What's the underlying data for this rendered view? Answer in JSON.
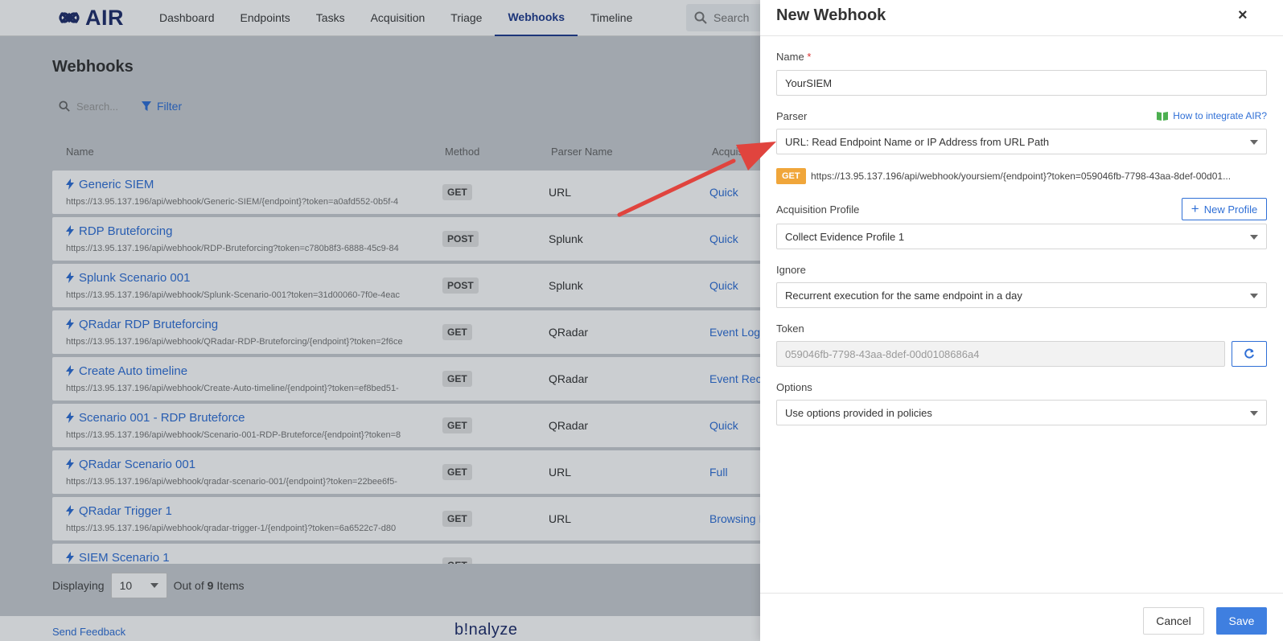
{
  "app": {
    "logo_text": "AIR"
  },
  "nav": {
    "items": [
      "Dashboard",
      "Endpoints",
      "Tasks",
      "Acquisition",
      "Triage",
      "Webhooks",
      "Timeline"
    ],
    "active": "Webhooks",
    "search_placeholder": "Search"
  },
  "page": {
    "title": "Webhooks",
    "search_placeholder": "Search...",
    "filter_label": "Filter"
  },
  "table": {
    "columns": [
      "Name",
      "Method",
      "Parser Name",
      "Acquisition"
    ],
    "rows": [
      {
        "name": "Generic SIEM",
        "url": "https://13.95.137.196/api/webhook/Generic-SIEM/{endpoint}?token=a0afd552-0b5f-4",
        "method": "GET",
        "parser": "URL",
        "acquisition": "Quick"
      },
      {
        "name": "RDP Bruteforcing",
        "url": "https://13.95.137.196/api/webhook/RDP-Bruteforcing?token=c780b8f3-6888-45c9-84",
        "method": "POST",
        "parser": "Splunk",
        "acquisition": "Quick"
      },
      {
        "name": "Splunk Scenario 001",
        "url": "https://13.95.137.196/api/webhook/Splunk-Scenario-001?token=31d00060-7f0e-4eac",
        "method": "POST",
        "parser": "Splunk",
        "acquisition": "Quick"
      },
      {
        "name": "QRadar RDP Bruteforcing",
        "url": "https://13.95.137.196/api/webhook/QRadar-RDP-Bruteforcing/{endpoint}?token=2f6ce",
        "method": "GET",
        "parser": "QRadar",
        "acquisition": "Event Logs"
      },
      {
        "name": "Create Auto timeline",
        "url": "https://13.95.137.196/api/webhook/Create-Auto-timeline/{endpoint}?token=ef8bed51-",
        "method": "GET",
        "parser": "QRadar",
        "acquisition": "Event Rec"
      },
      {
        "name": "Scenario 001 - RDP Bruteforce",
        "url": "https://13.95.137.196/api/webhook/Scenario-001-RDP-Bruteforce/{endpoint}?token=8",
        "method": "GET",
        "parser": "QRadar",
        "acquisition": "Quick"
      },
      {
        "name": "QRadar Scenario 001",
        "url": "https://13.95.137.196/api/webhook/qradar-scenario-001/{endpoint}?token=22bee6f5-",
        "method": "GET",
        "parser": "URL",
        "acquisition": "Full"
      },
      {
        "name": "QRadar Trigger 1",
        "url": "https://13.95.137.196/api/webhook/qradar-trigger-1/{endpoint}?token=6a6522c7-d80",
        "method": "GET",
        "parser": "URL",
        "acquisition": "Browsing I"
      },
      {
        "name": "SIEM Scenario 1",
        "url": "",
        "method": "GET",
        "parser": "",
        "acquisition": ""
      }
    ]
  },
  "footer": {
    "displaying_label": "Displaying",
    "page_size": "10",
    "out_of_label": "Out of",
    "total": "9",
    "items_label": "Items",
    "feedback": "Send Feedback",
    "brand": "b!nalyze"
  },
  "panel": {
    "title": "New Webhook",
    "close": "×",
    "name_label": "Name",
    "required_mark": "*",
    "name_value": "YourSIEM",
    "parser_label": "Parser",
    "help_link": "How to integrate AIR?",
    "parser_value": "URL: Read Endpoint Name or IP Address from URL Path",
    "method_badge": "GET",
    "webhook_url": "https://13.95.137.196/api/webhook/yoursiem/{endpoint}?token=059046fb-7798-43aa-8def-00d01...",
    "acq_profile_label": "Acquisition Profile",
    "new_profile_label": "New Profile",
    "acq_profile_value": "Collect Evidence Profile 1",
    "ignore_label": "Ignore",
    "ignore_value": "Recurrent execution for the same endpoint in a day",
    "token_label": "Token",
    "token_value": "059046fb-7798-43aa-8def-00d0108686a4",
    "options_label": "Options",
    "options_value": "Use options provided in policies",
    "cancel_label": "Cancel",
    "save_label": "Save"
  },
  "colors": {
    "accent": "#2f6fd6",
    "brand": "#1f2d6b",
    "get_badge": "#f0a63a",
    "save": "#3f7fe0",
    "arrow": "#e0443e"
  }
}
